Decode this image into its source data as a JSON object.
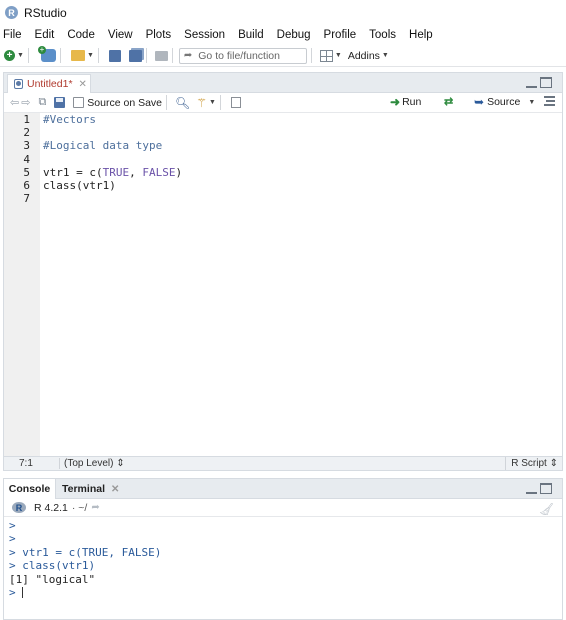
{
  "window": {
    "title": "RStudio",
    "logo_letter": "R"
  },
  "menu": [
    "File",
    "Edit",
    "Code",
    "View",
    "Plots",
    "Session",
    "Build",
    "Debug",
    "Profile",
    "Tools",
    "Help"
  ],
  "toolbar": {
    "goto_placeholder": "Go to file/function",
    "addins_label": "Addins"
  },
  "editor": {
    "tab_label": "Untitled1*",
    "source_on_save_label": "Source on Save",
    "source_on_save_checked": false,
    "run_label": "Run",
    "source_label": "Source",
    "line_numbers": [
      "1",
      "2",
      "3",
      "4",
      "5",
      "6",
      "7"
    ],
    "code_lines": [
      [
        {
          "t": "#Vectors",
          "k": "comment"
        }
      ],
      [],
      [
        {
          "t": "#Logical data type",
          "k": "comment"
        }
      ],
      [],
      [
        {
          "t": "vtr1 = c(",
          "k": "plain"
        },
        {
          "t": "TRUE",
          "k": "const"
        },
        {
          "t": ", ",
          "k": "plain"
        },
        {
          "t": "FALSE",
          "k": "const"
        },
        {
          "t": ")",
          "k": "plain"
        }
      ],
      [
        {
          "t": "class(vtr1)",
          "k": "plain"
        }
      ],
      []
    ],
    "status": {
      "cursor_position": "7:1",
      "scope": "(Top Level)",
      "file_type": "R Script"
    }
  },
  "console": {
    "tab_console": "Console",
    "tab_terminal": "Terminal",
    "r_version": "R 4.2.1",
    "working_dir": "· ~/",
    "lines": [
      {
        "prompt": ">",
        "text": "",
        "kind": "cmd"
      },
      {
        "prompt": ">",
        "text": "",
        "kind": "cmd"
      },
      {
        "prompt": ">",
        "text": "vtr1 = c(TRUE, FALSE)",
        "kind": "cmd"
      },
      {
        "prompt": ">",
        "text": "class(vtr1)",
        "kind": "cmd"
      },
      {
        "prompt": "",
        "text": "[1] \"logical\"",
        "kind": "out"
      },
      {
        "prompt": ">",
        "text": "",
        "kind": "cursor"
      }
    ]
  },
  "colors": {
    "comment": "#4d6f9c",
    "constant": "#6a52a8",
    "console_command": "#2a5a9a",
    "tab_modified": "#b03a2e",
    "run_green": "#2e8b3f"
  }
}
